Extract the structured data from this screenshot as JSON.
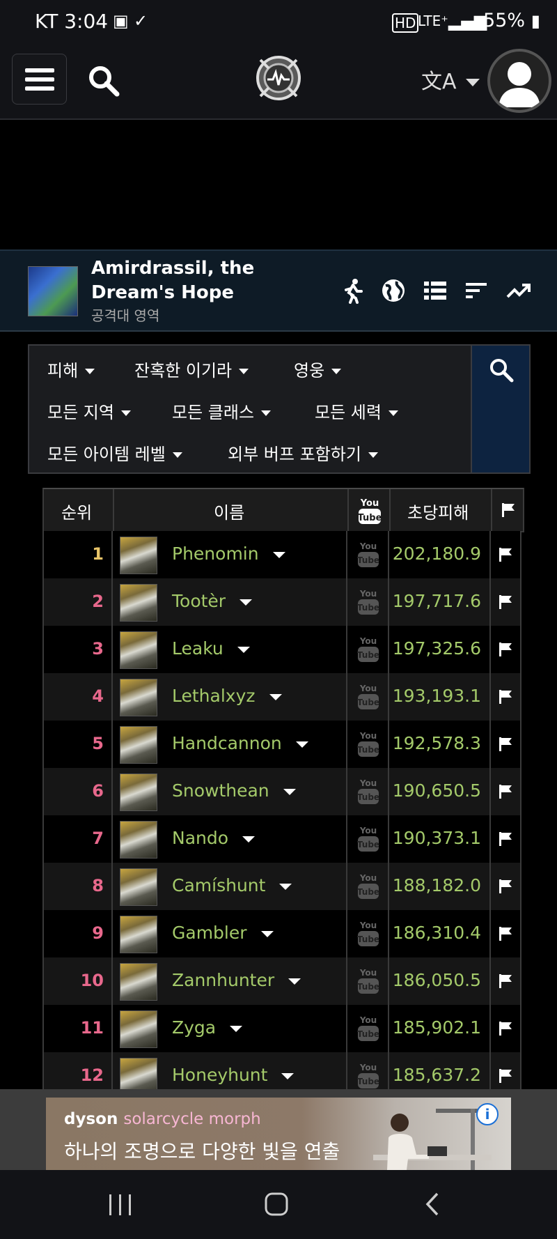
{
  "status_bar": {
    "carrier_time": "KT 3:04",
    "right": "55%"
  },
  "nav": {
    "lang_icon": "translate-icon"
  },
  "zone": {
    "title": "Amirdrassil, the Dream's Hope",
    "subtitle": "공격대 영역"
  },
  "filters": {
    "metric": "피해",
    "boss": "잔혹한 이기라",
    "difficulty": "영웅",
    "region": "모든 지역",
    "class": "모든 클래스",
    "faction": "모든 세력",
    "ilvl": "모든 아이템 레벨",
    "buffs": "외부 버프 포함하기"
  },
  "table": {
    "headers": {
      "rank": "순위",
      "name": "이름",
      "dps": "초당피해"
    },
    "rows": [
      {
        "rank": "1",
        "name": "Phenomin",
        "dps": "202,180.9"
      },
      {
        "rank": "2",
        "name": "Tootèr",
        "dps": "197,717.6"
      },
      {
        "rank": "3",
        "name": "Leaku",
        "dps": "197,325.6"
      },
      {
        "rank": "4",
        "name": "Lethalxyz",
        "dps": "193,193.1"
      },
      {
        "rank": "5",
        "name": "Handcannon",
        "dps": "192,578.3"
      },
      {
        "rank": "6",
        "name": "Snowthean",
        "dps": "190,650.5"
      },
      {
        "rank": "7",
        "name": "Nando",
        "dps": "190,373.1"
      },
      {
        "rank": "8",
        "name": "Camíshunt",
        "dps": "188,182.0"
      },
      {
        "rank": "9",
        "name": "Gambler",
        "dps": "186,310.4"
      },
      {
        "rank": "10",
        "name": "Zannhunter",
        "dps": "186,050.5"
      },
      {
        "rank": "11",
        "name": "Zyga",
        "dps": "185,902.1"
      },
      {
        "rank": "12",
        "name": "Honeyhunt",
        "dps": "185,637.2"
      }
    ]
  },
  "ad": {
    "brand": "dyson",
    "product": "solarcycle morph",
    "copy": "하나의 조명으로 다양한 빛을 연출"
  },
  "colors": {
    "rank_first": "#e8c468",
    "rank": "#e8688c",
    "name": "#a4ca6a",
    "dps": "#a4ca6a"
  }
}
